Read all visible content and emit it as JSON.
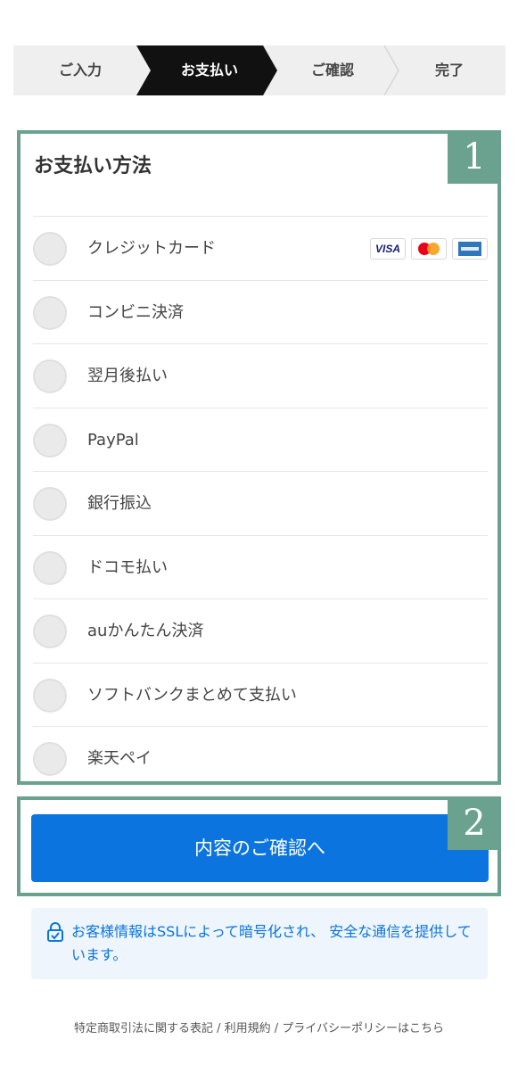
{
  "steps": {
    "items": [
      "ご入力",
      "お支払い",
      "ご確認",
      "完了"
    ],
    "active_index": 1
  },
  "payment": {
    "title": "お支払い方法",
    "badge": "1",
    "cards": [
      "VISA",
      "mastercard",
      "amex"
    ],
    "methods": [
      "クレジットカード",
      "コンビニ決済",
      "翌月後払い",
      "PayPal",
      "銀行振込",
      "ドコモ払い",
      "auかんたん決済",
      "ソフトバンクまとめて支払い",
      "楽天ペイ"
    ]
  },
  "confirm": {
    "badge": "2",
    "button_label": "内容のご確認へ"
  },
  "ssl_note": {
    "text": "お客様情報はSSLによって暗号化され、 安全な通信を提供しています。",
    "icon": "lock-icon"
  },
  "footer": {
    "text": "特定商取引法に関する表記 / 利用規約 / プライバシーポリシーはこちら"
  },
  "colors": {
    "accent": "#0b74de",
    "highlight": "#6aa28f",
    "active_step": "#111111",
    "ssl_bg": "#eef5fc"
  }
}
